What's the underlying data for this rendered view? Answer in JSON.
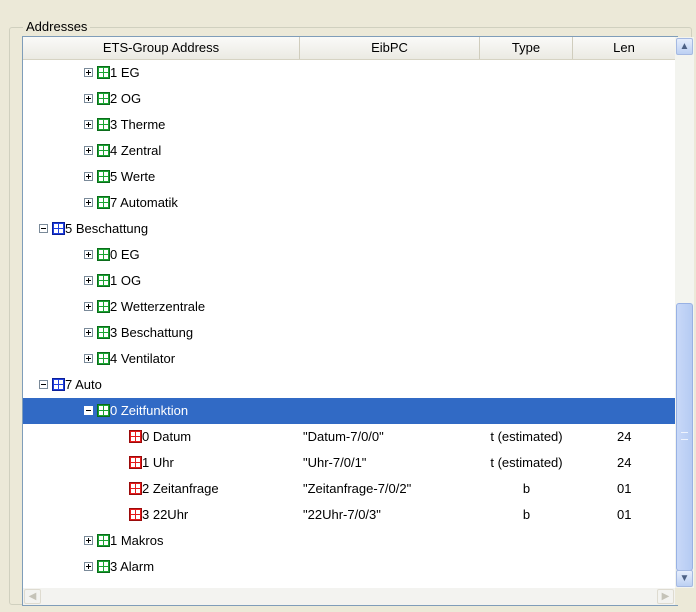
{
  "group_title": "Addresses",
  "columns": {
    "ets": "ETS-Group Address",
    "eibpc": "EibPC",
    "type": "Type",
    "len": "Len"
  },
  "rows": [
    {
      "level": 2,
      "expander": "plus",
      "icon": "green",
      "label": "1 EG"
    },
    {
      "level": 2,
      "expander": "plus",
      "icon": "green",
      "label": "2 OG"
    },
    {
      "level": 2,
      "expander": "plus",
      "icon": "green",
      "label": "3 Therme"
    },
    {
      "level": 2,
      "expander": "plus",
      "icon": "green",
      "label": "4 Zentral"
    },
    {
      "level": 2,
      "expander": "plus",
      "icon": "green",
      "label": "5 Werte"
    },
    {
      "level": 2,
      "expander": "plus",
      "icon": "green",
      "label": "7 Automatik"
    },
    {
      "level": 1,
      "expander": "minus",
      "icon": "blue",
      "label": "5 Beschattung"
    },
    {
      "level": 2,
      "expander": "plus",
      "icon": "green",
      "label": "0 EG"
    },
    {
      "level": 2,
      "expander": "plus",
      "icon": "green",
      "label": "1 OG"
    },
    {
      "level": 2,
      "expander": "plus",
      "icon": "green",
      "label": "2 Wetterzentrale"
    },
    {
      "level": 2,
      "expander": "plus",
      "icon": "green",
      "label": "3 Beschattung"
    },
    {
      "level": 2,
      "expander": "plus",
      "icon": "green",
      "label": "4 Ventilator"
    },
    {
      "level": 1,
      "expander": "minus",
      "icon": "blue",
      "label": "7 Auto"
    },
    {
      "level": 2,
      "expander": "minus",
      "icon": "green",
      "label": "0 Zeitfunktion",
      "selected": true
    },
    {
      "level": 3,
      "expander": "none",
      "icon": "red",
      "label": "0 Datum",
      "eibpc": "\"Datum-7/0/0\"",
      "type": "t (estimated)",
      "len": "24"
    },
    {
      "level": 3,
      "expander": "none",
      "icon": "red",
      "label": "1 Uhr",
      "eibpc": "\"Uhr-7/0/1\"",
      "type": "t (estimated)",
      "len": "24"
    },
    {
      "level": 3,
      "expander": "none",
      "icon": "red",
      "label": "2 Zeitanfrage",
      "eibpc": "\"Zeitanfrage-7/0/2\"",
      "type": "b",
      "len": "01"
    },
    {
      "level": 3,
      "expander": "none",
      "icon": "red",
      "label": "3 22Uhr",
      "eibpc": "\"22Uhr-7/0/3\"",
      "type": "b",
      "len": "01"
    },
    {
      "level": 2,
      "expander": "plus",
      "icon": "green",
      "label": "1 Makros"
    },
    {
      "level": 2,
      "expander": "plus",
      "icon": "green",
      "label": "3 Alarm"
    }
  ],
  "colors": {
    "selection": "#316ac5",
    "main_group_icon": "#1f3fe0",
    "middle_group_icon": "#19a531",
    "group_address_icon": "#e51b1b"
  },
  "icons": {
    "expand": "plus-box-icon",
    "collapse": "minus-box-icon",
    "scroll_up": "arrow-up-icon",
    "scroll_down": "arrow-down-icon",
    "scroll_left": "arrow-left-icon",
    "scroll_right": "arrow-right-icon"
  }
}
